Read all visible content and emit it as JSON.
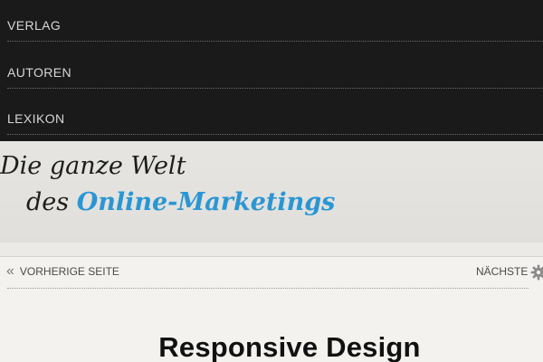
{
  "nav": {
    "items": [
      {
        "label": "VERLAG"
      },
      {
        "label": "AUTOREN"
      },
      {
        "label": "LEXIKON"
      }
    ]
  },
  "hero": {
    "line1": "Die ganze Welt",
    "line2_prefix": "des ",
    "line2_accent": "Online-Marketings",
    "accent_color": "#2a96d4"
  },
  "pager": {
    "prev_icon": "double-chevron-left-icon",
    "prev_label": "VORHERIGE SEITE",
    "next_label": "NÄCHSTE SEITE",
    "settings_icon": "gear-icon"
  },
  "post": {
    "title": "Responsive Design"
  },
  "colors": {
    "nav_bg": "#1b1a1a",
    "hero_bg": "#e6e5e2",
    "page_bg": "#f3f2ef"
  }
}
